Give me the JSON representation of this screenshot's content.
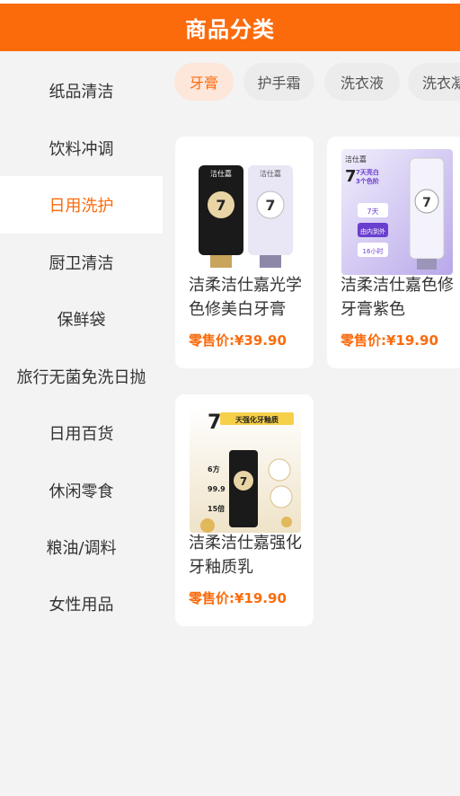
{
  "header": {
    "title": "商品分类"
  },
  "sidebar": {
    "items": [
      {
        "label": "纸品清洁",
        "active": false
      },
      {
        "label": "饮料冲调",
        "active": false
      },
      {
        "label": "日用洗护",
        "active": true
      },
      {
        "label": "厨卫清洁",
        "active": false
      },
      {
        "label": "保鲜袋",
        "active": false
      },
      {
        "label": "旅行无菌免洗日抛",
        "active": false
      },
      {
        "label": "日用百货",
        "active": false
      },
      {
        "label": "休闲零食",
        "active": false
      },
      {
        "label": "粮油/调料",
        "active": false
      },
      {
        "label": "女性用品",
        "active": false
      }
    ]
  },
  "tabs": [
    {
      "label": "牙膏",
      "active": true
    },
    {
      "label": "护手霜",
      "active": false
    },
    {
      "label": "洗衣液",
      "active": false
    },
    {
      "label": "洗衣凝",
      "active": false
    }
  ],
  "products": [
    {
      "name": "洁柔洁仕嘉光学色修美白牙膏",
      "price_label": "零售价:",
      "price": "¥39.90"
    },
    {
      "name": "洁柔洁仕嘉色修牙膏紫色",
      "price_label": "零售价:",
      "price": "¥19.90"
    },
    {
      "name": "洁柔洁仕嘉强化牙釉质乳",
      "price_label": "零售价:",
      "price": "¥19.90"
    }
  ],
  "image_text": {
    "brand": "洁仕嘉",
    "p2_headline_day": "7天亮白",
    "p2_headline_rest": "3个色阶",
    "p2_badge1": "7天",
    "p2_badge2": "由内到外",
    "p2_badge3": "16小时",
    "p3_headline": "天强化牙釉质",
    "p3_stat1": "6方",
    "p3_stat2": "99.9",
    "p3_stat3": "15倍"
  },
  "colors": {
    "accent": "#fb6b0c",
    "tab_active_bg": "#fde6da"
  }
}
